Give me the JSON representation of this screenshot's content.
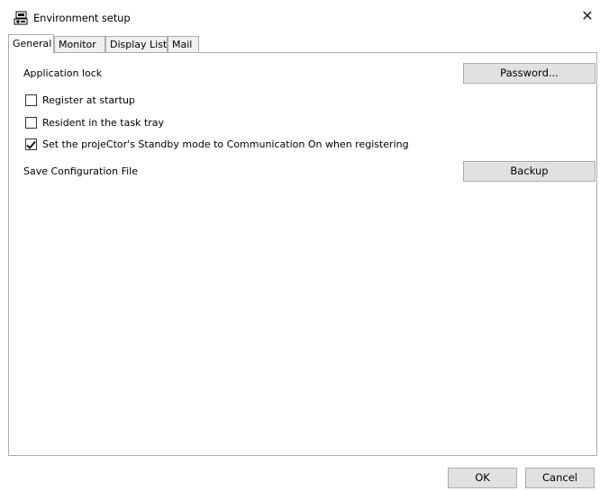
{
  "window": {
    "title": "Environment setup",
    "close_glyph": "✕"
  },
  "tabs": [
    {
      "label": "General",
      "active": true
    },
    {
      "label": "Monitor",
      "active": false
    },
    {
      "label": "Display List",
      "active": false
    },
    {
      "label": "Mail",
      "active": false
    }
  ],
  "general": {
    "application_lock_label": "Application lock",
    "password_button": "Password...",
    "checkboxes": [
      {
        "label": "Register at startup",
        "checked": false
      },
      {
        "label": "Resident in the task tray",
        "checked": false
      },
      {
        "label": "Set the projeCtor's Standby mode to Communication On when registering",
        "checked": true
      }
    ],
    "save_config_label": "Save Configuration File",
    "backup_button": "Backup"
  },
  "footer": {
    "ok_button": "OK",
    "cancel_button": "Cancel"
  },
  "icons": {
    "app": "projector-computer-icon",
    "check": "checkmark-icon"
  },
  "colors": {
    "button_face": "#e1e1e1",
    "border": "#adadad"
  }
}
